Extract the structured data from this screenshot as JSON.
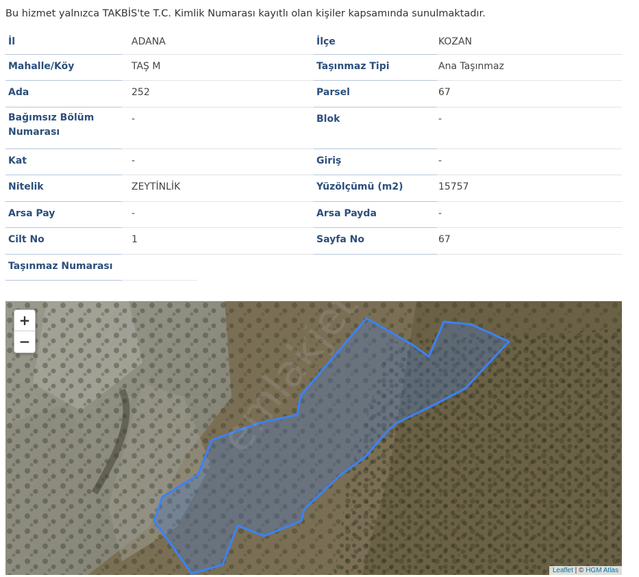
{
  "notice": "Bu hizmet yalnızca TAKBİS'te T.C. Kimlik Numarası kayıtlı olan kişiler kapsamında sunulmaktadır.",
  "fields": [
    {
      "l1": "İl",
      "v1": "ADANA",
      "l2": "İlçe",
      "v2": "KOZAN"
    },
    {
      "l1": "Mahalle/Köy",
      "v1": "TAŞ M",
      "l2": "Taşınmaz Tipi",
      "v2": "Ana Taşınmaz"
    },
    {
      "l1": "Ada",
      "v1": "252",
      "l2": "Parsel",
      "v2": "67"
    },
    {
      "l1": "Bağımsız Bölüm Numarası",
      "v1": "-",
      "l2": "Blok",
      "v2": "-"
    },
    {
      "l1": "Kat",
      "v1": "-",
      "l2": "Giriş",
      "v2": "-"
    },
    {
      "l1": "Nitelik",
      "v1": "ZEYTİNLİK",
      "l2": "Yüzölçümü (m2)",
      "v2": "15757"
    },
    {
      "l1": "Arsa Pay",
      "v1": "-",
      "l2": "Arsa Payda",
      "v2": "-"
    },
    {
      "l1": "Cilt No",
      "v1": "1",
      "l2": "Sayfa No",
      "v2": "67"
    },
    {
      "l1": "Taşınmaz Numarası",
      "v1": "",
      "l2": "",
      "v2": ""
    }
  ],
  "watermark": "emlakjet.com",
  "map": {
    "zoom_in": "+",
    "zoom_out": "−",
    "attribution_leaflet": "Leaflet",
    "attribution_sep": " | © ",
    "attribution_hgm": "HGM Atlas",
    "parcel_color": "#3b82f6"
  }
}
